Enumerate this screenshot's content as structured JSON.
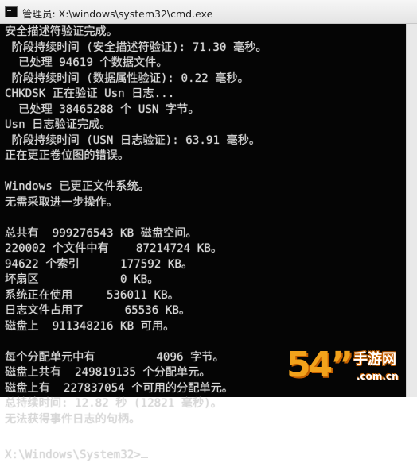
{
  "window": {
    "title": "管理员: X:\\windows\\system32\\cmd.exe",
    "icon": "cmd-icon"
  },
  "console": {
    "lines": [
      "安全描述符验证完成。",
      " 阶段持续时间 (安全描述符验证): 71.30 毫秒。",
      "  已处理 94619 个数据文件。",
      " 阶段持续时间 (数据属性验证): 0.22 毫秒。",
      "CHKDSK 正在验证 Usn 日志...",
      "  已处理 38465288 个 USN 字节。",
      "Usn 日志验证完成。",
      " 阶段持续时间 (USN 日志验证): 63.91 毫秒。",
      "正在更正卷位图的错误。",
      "",
      "Windows 已更正文件系统。",
      "无需采取进一步操作。",
      "",
      "总共有  999276543 KB 磁盘空间。",
      "220002 个文件中有    87214724 KB。",
      "94622 个索引      177592 KB。",
      "坏扇区            0 KB。",
      "系统正在使用     536011 KB。",
      "日志文件占用了      65536 KB。",
      "磁盘上  911348216 KB 可用。",
      "",
      "每个分配单元中有         4096 字节。",
      "磁盘上共有  249819135 个分配单元。",
      "磁盘上有  227837054 个可用的分配单元。",
      "总持续时间: 12.82 秒 (12821 毫秒)。",
      "无法获得事件日志的句柄。"
    ],
    "prompt": "X:\\Windows\\System32>"
  },
  "watermark": {
    "number": "54”",
    "site": "手游网",
    "domain": ".com.cn"
  },
  "colors": {
    "console_bg": "#050505",
    "console_text": "#d8d8d8",
    "watermark_orange": "#f2a21b"
  }
}
